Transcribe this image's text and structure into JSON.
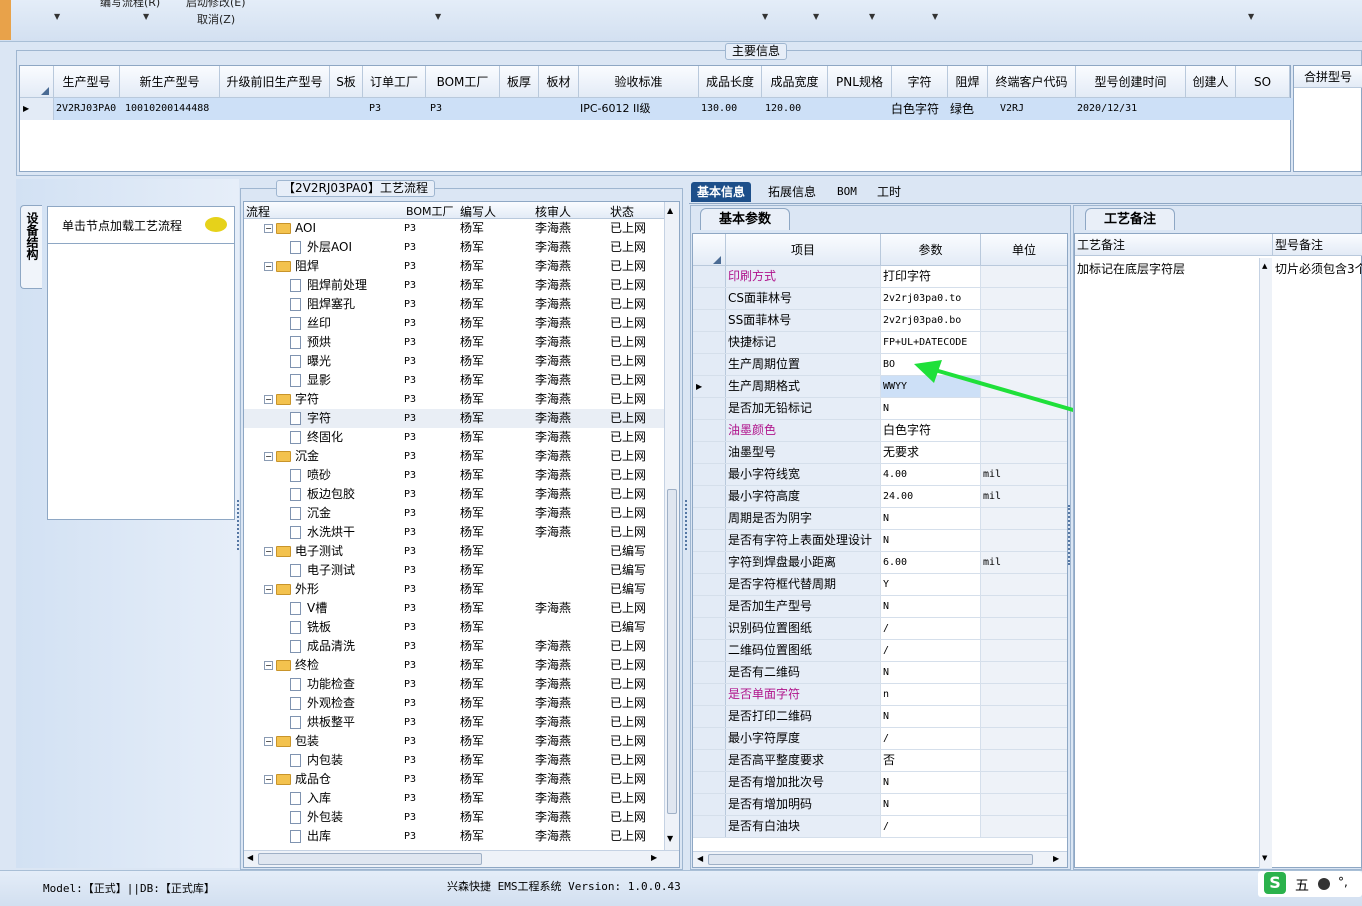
{
  "ribbon": {
    "btn1": "编写流程(R)",
    "btn2": "启动修改(E)",
    "btn3": "取消(Z)"
  },
  "main_group_title": "主要信息",
  "top_grid": {
    "headers": [
      "生产型号",
      "新生产型号",
      "升级前旧生产型号",
      "S板",
      "订单工厂",
      "BOM工厂",
      "板厚",
      "板材",
      "验收标准",
      "成品长度",
      "成品宽度",
      "PNL规格",
      "字符",
      "阻焊",
      "终端客户代码",
      "型号创建时间",
      "创建人",
      "SO"
    ],
    "row": [
      "2V2RJ03PA0",
      "10010200144488",
      "",
      "",
      "P3",
      "P3",
      "",
      "",
      "IPC-6012 II级",
      "130.00",
      "120.00",
      "",
      "白色字符",
      "绿色",
      "V2RJ",
      "2020/12/31",
      "",
      ""
    ],
    "right_header": "合拼型号"
  },
  "left_panel": {
    "vertical_tab": "设备结构",
    "node_hint": "单击节点加载工艺流程"
  },
  "tree_title": "【2V2RJ03PA0】工艺流程",
  "tree_headers": [
    "流程",
    "BOM工厂",
    "编写人",
    "核审人",
    "状态"
  ],
  "tree_rows": [
    {
      "level": 1,
      "name": "AOI",
      "bom": "P3",
      "writer": "杨军",
      "reviewer": "李海燕",
      "status": "已上网"
    },
    {
      "level": 2,
      "name": "外层AOI",
      "bom": "P3",
      "writer": "杨军",
      "reviewer": "李海燕",
      "status": "已上网"
    },
    {
      "level": 1,
      "name": "阻焊",
      "bom": "P3",
      "writer": "杨军",
      "reviewer": "李海燕",
      "status": "已上网"
    },
    {
      "level": 2,
      "name": "阻焊前处理",
      "bom": "P3",
      "writer": "杨军",
      "reviewer": "李海燕",
      "status": "已上网"
    },
    {
      "level": 2,
      "name": "阻焊塞孔",
      "bom": "P3",
      "writer": "杨军",
      "reviewer": "李海燕",
      "status": "已上网"
    },
    {
      "level": 2,
      "name": "丝印",
      "bom": "P3",
      "writer": "杨军",
      "reviewer": "李海燕",
      "status": "已上网"
    },
    {
      "level": 2,
      "name": "预烘",
      "bom": "P3",
      "writer": "杨军",
      "reviewer": "李海燕",
      "status": "已上网"
    },
    {
      "level": 2,
      "name": "曝光",
      "bom": "P3",
      "writer": "杨军",
      "reviewer": "李海燕",
      "status": "已上网"
    },
    {
      "level": 2,
      "name": "显影",
      "bom": "P3",
      "writer": "杨军",
      "reviewer": "李海燕",
      "status": "已上网"
    },
    {
      "level": 1,
      "name": "字符",
      "bom": "P3",
      "writer": "杨军",
      "reviewer": "李海燕",
      "status": "已上网"
    },
    {
      "level": 2,
      "name": "字符",
      "bom": "P3",
      "writer": "杨军",
      "reviewer": "李海燕",
      "status": "已上网",
      "selected": true
    },
    {
      "level": 2,
      "name": "终固化",
      "bom": "P3",
      "writer": "杨军",
      "reviewer": "李海燕",
      "status": "已上网"
    },
    {
      "level": 1,
      "name": "沉金",
      "bom": "P3",
      "writer": "杨军",
      "reviewer": "李海燕",
      "status": "已上网"
    },
    {
      "level": 2,
      "name": "喷砂",
      "bom": "P3",
      "writer": "杨军",
      "reviewer": "李海燕",
      "status": "已上网"
    },
    {
      "level": 2,
      "name": "板边包胶",
      "bom": "P3",
      "writer": "杨军",
      "reviewer": "李海燕",
      "status": "已上网"
    },
    {
      "level": 2,
      "name": "沉金",
      "bom": "P3",
      "writer": "杨军",
      "reviewer": "李海燕",
      "status": "已上网"
    },
    {
      "level": 2,
      "name": "水洗烘干",
      "bom": "P3",
      "writer": "杨军",
      "reviewer": "李海燕",
      "status": "已上网"
    },
    {
      "level": 1,
      "name": "电子测试",
      "bom": "P3",
      "writer": "杨军",
      "reviewer": "",
      "status": "已编写"
    },
    {
      "level": 2,
      "name": "电子测试",
      "bom": "P3",
      "writer": "杨军",
      "reviewer": "",
      "status": "已编写"
    },
    {
      "level": 1,
      "name": "外形",
      "bom": "P3",
      "writer": "杨军",
      "reviewer": "",
      "status": "已编写"
    },
    {
      "level": 2,
      "name": "V槽",
      "bom": "P3",
      "writer": "杨军",
      "reviewer": "李海燕",
      "status": "已上网"
    },
    {
      "level": 2,
      "name": "铣板",
      "bom": "P3",
      "writer": "杨军",
      "reviewer": "",
      "status": "已编写"
    },
    {
      "level": 2,
      "name": "成品清洗",
      "bom": "P3",
      "writer": "杨军",
      "reviewer": "李海燕",
      "status": "已上网"
    },
    {
      "level": 1,
      "name": "终检",
      "bom": "P3",
      "writer": "杨军",
      "reviewer": "李海燕",
      "status": "已上网"
    },
    {
      "level": 2,
      "name": "功能检查",
      "bom": "P3",
      "writer": "杨军",
      "reviewer": "李海燕",
      "status": "已上网"
    },
    {
      "level": 2,
      "name": "外观检查",
      "bom": "P3",
      "writer": "杨军",
      "reviewer": "李海燕",
      "status": "已上网"
    },
    {
      "level": 2,
      "name": "烘板整平",
      "bom": "P3",
      "writer": "杨军",
      "reviewer": "李海燕",
      "status": "已上网"
    },
    {
      "level": 1,
      "name": "包装",
      "bom": "P3",
      "writer": "杨军",
      "reviewer": "李海燕",
      "status": "已上网"
    },
    {
      "level": 2,
      "name": "内包装",
      "bom": "P3",
      "writer": "杨军",
      "reviewer": "李海燕",
      "status": "已上网"
    },
    {
      "level": 1,
      "name": "成品仓",
      "bom": "P3",
      "writer": "杨军",
      "reviewer": "李海燕",
      "status": "已上网"
    },
    {
      "level": 2,
      "name": "入库",
      "bom": "P3",
      "writer": "杨军",
      "reviewer": "李海燕",
      "status": "已上网"
    },
    {
      "level": 2,
      "name": "外包装",
      "bom": "P3",
      "writer": "杨军",
      "reviewer": "李海燕",
      "status": "已上网"
    },
    {
      "level": 2,
      "name": "出库",
      "bom": "P3",
      "writer": "杨军",
      "reviewer": "李海燕",
      "status": "已上网"
    }
  ],
  "tabs": [
    "基本信息",
    "拓展信息",
    "BOM",
    "工时"
  ],
  "param_group_title": "基本参数",
  "param_headers": [
    "项目",
    "参数",
    "单位"
  ],
  "params": [
    {
      "item": "印刷方式",
      "value": "打印字符",
      "unit": "",
      "highlight": true
    },
    {
      "item": "CS面菲林号",
      "value": "2v2rj03pa0.to",
      "unit": ""
    },
    {
      "item": "SS面菲林号",
      "value": "2v2rj03pa0.bo",
      "unit": ""
    },
    {
      "item": "快捷标记",
      "value": "FP+UL+DATECODE",
      "unit": ""
    },
    {
      "item": "生产周期位置",
      "value": "BO",
      "unit": ""
    },
    {
      "item": "生产周期格式",
      "value": "WWYY",
      "unit": "",
      "current": true
    },
    {
      "item": "是否加无铅标记",
      "value": "N",
      "unit": ""
    },
    {
      "item": "油墨颜色",
      "value": "白色字符",
      "unit": "",
      "highlight": true
    },
    {
      "item": "油墨型号",
      "value": "无要求",
      "unit": ""
    },
    {
      "item": "最小字符线宽",
      "value": "4.00",
      "unit": "mil"
    },
    {
      "item": "最小字符高度",
      "value": "24.00",
      "unit": "mil"
    },
    {
      "item": "周期是否为阴字",
      "value": "N",
      "unit": ""
    },
    {
      "item": "是否有字符上表面处理设计",
      "value": "N",
      "unit": ""
    },
    {
      "item": "字符到焊盘最小距离",
      "value": "6.00",
      "unit": "mil"
    },
    {
      "item": "是否字符框代替周期",
      "value": "Y",
      "unit": ""
    },
    {
      "item": "是否加生产型号",
      "value": "N",
      "unit": ""
    },
    {
      "item": "识别码位置图纸",
      "value": "/",
      "unit": ""
    },
    {
      "item": "二维码位置图纸",
      "value": "/",
      "unit": ""
    },
    {
      "item": "是否有二维码",
      "value": "N",
      "unit": ""
    },
    {
      "item": "是否单面字符",
      "value": "n",
      "unit": "",
      "highlight": true
    },
    {
      "item": "是否打印二维码",
      "value": "N",
      "unit": ""
    },
    {
      "item": "最小字符厚度",
      "value": "/",
      "unit": ""
    },
    {
      "item": "是否高平整度要求",
      "value": "否",
      "unit": ""
    },
    {
      "item": "是否有增加批次号",
      "value": "N",
      "unit": ""
    },
    {
      "item": "是否有增加明码",
      "value": "N",
      "unit": ""
    },
    {
      "item": "是否有白油块",
      "value": "/",
      "unit": ""
    }
  ],
  "remark_group_title": "工艺备注",
  "remark_headers": [
    "工艺备注",
    "型号备注"
  ],
  "remark_values": [
    "加标记在底层字符层",
    "切片必须包含3个"
  ],
  "status_bar": {
    "left": "Model:【正式】||DB:【正式库】",
    "center": "兴森快捷 EMS工程系统 Version: 1.0.0.43",
    "ime": "五"
  },
  "colors": {
    "highlight_text": "#b0148c",
    "selection": "#cde0f7",
    "arrow": "#1fe03a",
    "tab_active": "#1d4f8a"
  }
}
